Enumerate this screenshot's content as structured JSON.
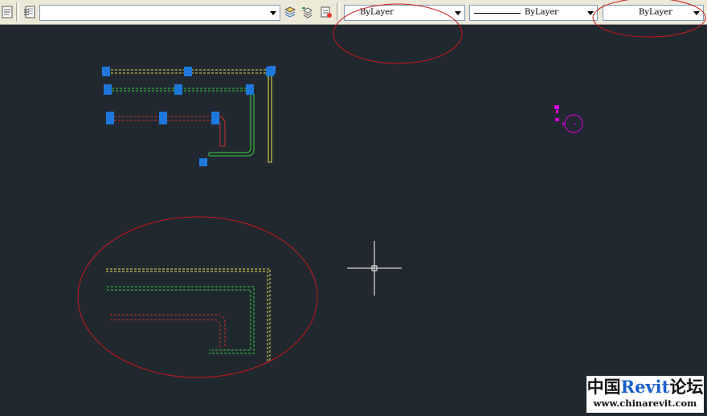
{
  "toolbar": {
    "icons": [
      "layer-states-icon",
      "layer-properties-icon",
      "make-object-layer-current-icon",
      "layer-previous-icon",
      "layer-isolate-icon"
    ],
    "layer_combo": {
      "value": ""
    },
    "color_combo": {
      "value": "ByLayer"
    },
    "linetype_combo": {
      "value": "ByLayer"
    },
    "lineweight_combo": {
      "value": "ByLayer"
    }
  },
  "canvas": {
    "background": "#212830",
    "colors": {
      "yellow_duct": "#e6e64a",
      "green_duct": "#3cd23c",
      "red_duct": "#c83232",
      "grip": "#1e78dc",
      "annotation_ellipse": "#cc1a1a",
      "magenta_object": "#e000e0",
      "crosshair": "#ffffff"
    }
  },
  "watermark": {
    "title_prefix": "中国",
    "title_brand": "Revit",
    "title_suffix": "论坛",
    "url": "www.chinarevit.com"
  }
}
